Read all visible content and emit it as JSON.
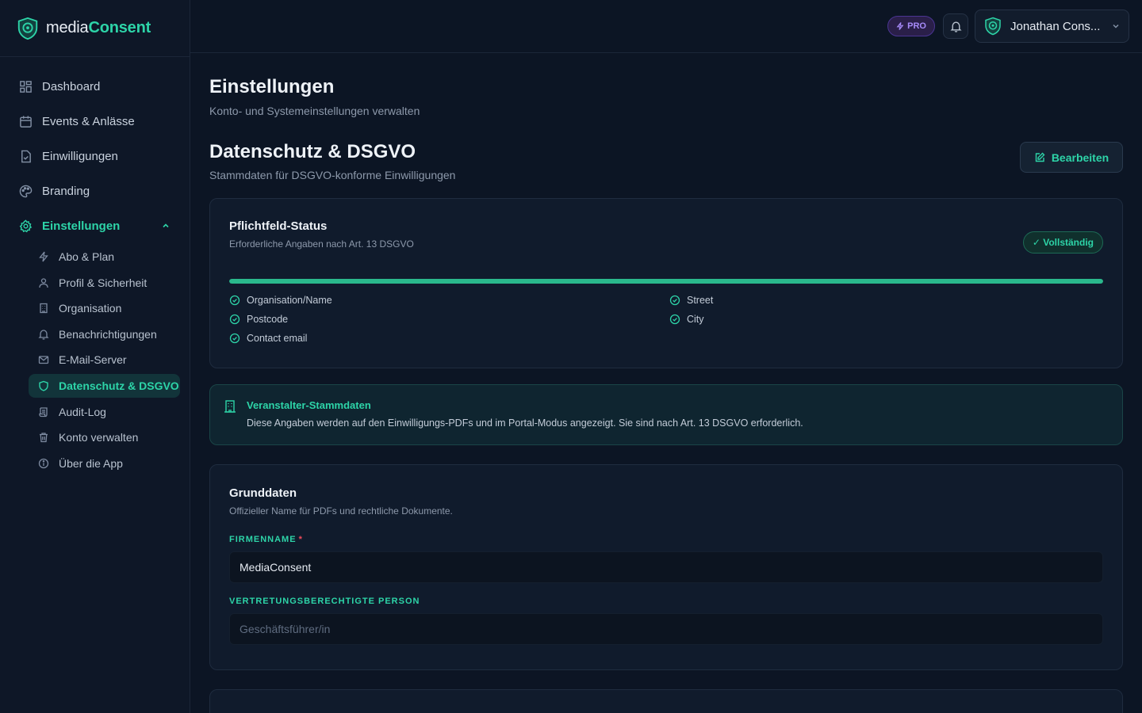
{
  "brand": {
    "name_prefix": "media",
    "name_accent": "Consent"
  },
  "nav": {
    "items": [
      {
        "label": "Dashboard",
        "icon": "dashboard-icon"
      },
      {
        "label": "Events & Anlässe",
        "icon": "calendar-icon"
      },
      {
        "label": "Einwilligungen",
        "icon": "document-check-icon"
      },
      {
        "label": "Branding",
        "icon": "palette-icon"
      },
      {
        "label": "Einstellungen",
        "icon": "gear-icon",
        "active": true
      }
    ],
    "sub_items": [
      {
        "label": "Abo & Plan",
        "icon": "bolt-icon"
      },
      {
        "label": "Profil & Sicherheit",
        "icon": "user-icon"
      },
      {
        "label": "Organisation",
        "icon": "building-icon"
      },
      {
        "label": "Benachrichtigungen",
        "icon": "bell-icon"
      },
      {
        "label": "E-Mail-Server",
        "icon": "mail-icon"
      },
      {
        "label": "Datenschutz & DSGVO",
        "icon": "shield-icon",
        "active": true
      },
      {
        "label": "Audit-Log",
        "icon": "scroll-icon"
      },
      {
        "label": "Konto verwalten",
        "icon": "trash-icon"
      },
      {
        "label": "Über die App",
        "icon": "info-icon"
      }
    ]
  },
  "header": {
    "pro_label": "PRO",
    "user_name": "Jonathan Cons..."
  },
  "page": {
    "title": "Einstellungen",
    "subtitle": "Konto- und Systemeinstellungen verwalten"
  },
  "section": {
    "title": "Datenschutz & DSGVO",
    "subtitle": "Stammdaten für DSGVO-konforme Einwilligungen",
    "edit_label": "Bearbeiten"
  },
  "status": {
    "title": "Pflichtfeld-Status",
    "subtitle": "Erforderliche Angaben nach Art. 13 DSGVO",
    "badge": "✓ Vollständig",
    "progress_percent": 100,
    "checks": [
      "Organisation/Name",
      "Street",
      "Postcode",
      "City",
      "Contact email"
    ]
  },
  "info": {
    "title": "Veranstalter-Stammdaten",
    "text": "Diese Angaben werden auf den Einwilligungs-PDFs und im Portal-Modus angezeigt. Sie sind nach Art. 13 DSGVO erforderlich."
  },
  "basics": {
    "title": "Grunddaten",
    "subtitle": "Offizieller Name für PDFs und rechtliche Dokumente.",
    "company_label": "FIRMENNAME",
    "company_required": "*",
    "company_value": "MediaConsent",
    "rep_label": "VERTRETUNGSBERECHTIGTE PERSON",
    "rep_placeholder": "Geschäftsführer/in"
  },
  "colors": {
    "accent": "#2dd4a8",
    "background": "#0c1524",
    "pro": "#a78bfa"
  }
}
